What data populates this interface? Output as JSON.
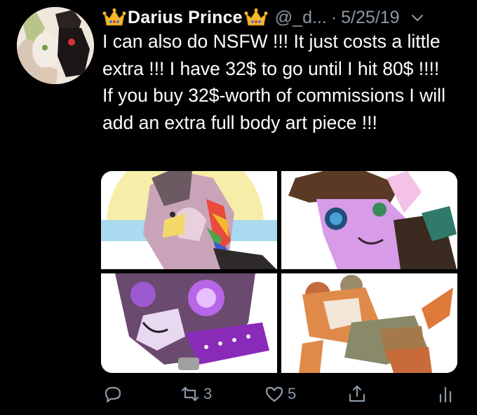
{
  "tweet": {
    "display_name": "Darius Prince",
    "handle": "@_d...",
    "separator": "·",
    "date": "5/25/19",
    "text": "I can also do NSFW !!! It just costs a little extra !!! I have 32$ to go until I hit 80$ !!!! If you buy 32$-worth of commissions I will add an extra full body art piece !!!",
    "name_emoji": "crown-emoji",
    "media": [
      {
        "icon": "artwork-1",
        "description_hidden": true
      },
      {
        "icon": "artwork-2",
        "description_hidden": true
      },
      {
        "icon": "artwork-3",
        "description_hidden": true
      },
      {
        "icon": "artwork-4",
        "description_hidden": true
      }
    ]
  },
  "actions": {
    "reply_count": "",
    "retweet_count": "3",
    "like_count": "5",
    "share_count": "",
    "analytics_count": ""
  },
  "colors": {
    "background": "#000000",
    "text": "#ffffff",
    "muted": "#8b98a5",
    "crown": "#f5b82e"
  }
}
